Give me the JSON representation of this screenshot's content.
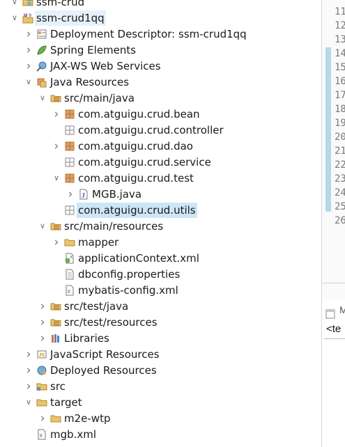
{
  "explorer": {
    "rows": [
      {
        "label": "ssm-crud",
        "icon": "web-project-icon",
        "arrow": "expanded",
        "depth": 0
      },
      {
        "label": "ssm-crud1qq",
        "icon": "maven-web-project-icon",
        "arrow": "expanded",
        "depth": 0,
        "highlight": true
      },
      {
        "label": "Deployment Descriptor: ssm-crud1qq",
        "icon": "deployment-descriptor-icon",
        "arrow": "collapsed",
        "depth": 1
      },
      {
        "label": "Spring Elements",
        "icon": "spring-leaf-icon",
        "arrow": "collapsed",
        "depth": 1
      },
      {
        "label": "JAX-WS Web Services",
        "icon": "web-services-icon",
        "arrow": "collapsed",
        "depth": 1
      },
      {
        "label": "Java Resources",
        "icon": "java-resources-icon",
        "arrow": "expanded",
        "depth": 1
      },
      {
        "label": "src/main/java",
        "icon": "source-folder-icon",
        "arrow": "expanded",
        "depth": 2
      },
      {
        "label": "com.atguigu.crud.bean",
        "icon": "package-icon",
        "arrow": "collapsed",
        "depth": 3
      },
      {
        "label": "com.atguigu.crud.controller",
        "icon": "empty-package-icon",
        "arrow": "none",
        "depth": 3
      },
      {
        "label": "com.atguigu.crud.dao",
        "icon": "package-icon",
        "arrow": "collapsed",
        "depth": 3
      },
      {
        "label": "com.atguigu.crud.service",
        "icon": "empty-package-icon",
        "arrow": "none",
        "depth": 3
      },
      {
        "label": "com.atguigu.crud.test",
        "icon": "package-icon",
        "arrow": "expanded",
        "depth": 3
      },
      {
        "label": "MGB.java",
        "icon": "java-file-icon",
        "arrow": "collapsed",
        "depth": 4
      },
      {
        "label": "com.atguigu.crud.utils",
        "icon": "empty-package-icon",
        "arrow": "none",
        "depth": 3,
        "selected": true
      },
      {
        "label": "src/main/resources",
        "icon": "source-folder-icon",
        "arrow": "expanded",
        "depth": 2
      },
      {
        "label": "mapper",
        "icon": "folder-icon",
        "arrow": "collapsed",
        "depth": 3
      },
      {
        "label": "applicationContext.xml",
        "icon": "spring-xml-icon",
        "arrow": "none",
        "depth": 3
      },
      {
        "label": "dbconfig.properties",
        "icon": "properties-file-icon",
        "arrow": "none",
        "depth": 3
      },
      {
        "label": "mybatis-config.xml",
        "icon": "xml-file-icon",
        "arrow": "none",
        "depth": 3
      },
      {
        "label": "src/test/java",
        "icon": "source-folder-icon",
        "arrow": "collapsed",
        "depth": 2
      },
      {
        "label": "src/test/resources",
        "icon": "source-folder-icon",
        "arrow": "collapsed",
        "depth": 2
      },
      {
        "label": "Libraries",
        "icon": "libraries-icon",
        "arrow": "collapsed",
        "depth": 2
      },
      {
        "label": "JavaScript Resources",
        "icon": "javascript-resources-icon",
        "arrow": "collapsed",
        "depth": 1
      },
      {
        "label": "Deployed Resources",
        "icon": "deployed-resources-icon",
        "arrow": "collapsed",
        "depth": 1
      },
      {
        "label": "src",
        "icon": "src-folder-icon",
        "arrow": "collapsed",
        "depth": 1
      },
      {
        "label": "target",
        "icon": "folder-icon",
        "arrow": "expanded",
        "depth": 1
      },
      {
        "label": "m2e-wtp",
        "icon": "folder-icon",
        "arrow": "collapsed",
        "depth": 2
      },
      {
        "label": "mgb.xml",
        "icon": "xml-file-icon",
        "arrow": "none",
        "depth": 1
      }
    ]
  },
  "editor": {
    "line_numbers": [
      "11",
      "12",
      "13",
      "14",
      "15",
      "16",
      "17",
      "18",
      "19",
      "20",
      "21",
      "22",
      "23",
      "24",
      "25",
      "26"
    ],
    "lower_tab_label": "M",
    "lower_tab_text": "<te"
  },
  "colors": {
    "selection": "#cde6f7",
    "highlight": "#e6f1fb",
    "ruler": "#b7d8e6",
    "package_brown": "#b4743a",
    "folder_yellow": "#e9c46a"
  }
}
